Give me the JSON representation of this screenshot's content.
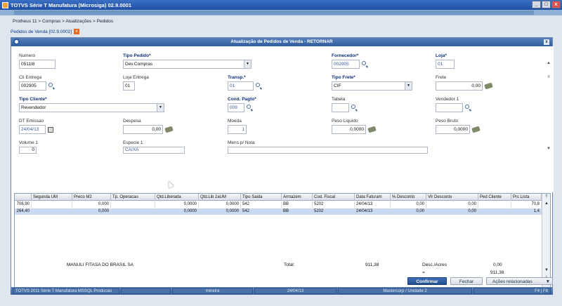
{
  "window": {
    "title": "TOTVS Série T Manufatura (Microsiga) 02.9.0001",
    "controls": [
      "_",
      "□",
      "x"
    ]
  },
  "breadcrumb": "Protheus 11 > Compras > Atualizações > Pedidos",
  "route_tab": {
    "label": "Pedidos de Venda [02.9.0002]",
    "close": "x"
  },
  "dialog": {
    "title": "Atualização de Pedidos de Venda - RETORNAR",
    "close": "x"
  },
  "form": {
    "numero": {
      "label": "Numero",
      "value": "0511I8"
    },
    "tipo_pedido": {
      "label": "Tipo Pedido*",
      "value": "Dev.Compras"
    },
    "fornecedor": {
      "label": "Fornecedor*",
      "value": "002905"
    },
    "loja": {
      "label": "Loja*",
      "value": "01"
    },
    "cli_entrega": {
      "label": "Cli Entrega",
      "value": "002905"
    },
    "loja_entrega": {
      "label": "Loja Entrega",
      "value": "01"
    },
    "transp": {
      "label": "Transp.*",
      "value": "01"
    },
    "tipo_frete": {
      "label": "Tipo Frete*",
      "value": "CIF"
    },
    "frete": {
      "label": "Frete",
      "value": "0,00"
    },
    "tipo_cliente": {
      "label": "Tipo Cliente*",
      "value": "Revendedor"
    },
    "cond_pagto": {
      "label": "Cond. Pagto*",
      "value": "009"
    },
    "tabela": {
      "label": "Tabela",
      "value": ""
    },
    "vendedor1": {
      "label": "Vendedor 1",
      "value": ""
    },
    "dt_emissao": {
      "label": "DT Emissao",
      "value": "24/04/13"
    },
    "despesa": {
      "label": "Despesa",
      "value": "0,00"
    },
    "moeda": {
      "label": "Moeda",
      "value": "1"
    },
    "peso_liquido": {
      "label": "Peso Liquido",
      "value": "0,0000"
    },
    "peso_bruto": {
      "label": "Peso Bruto",
      "value": "0,0000"
    },
    "volume1": {
      "label": "Volume 1",
      "value": "0"
    },
    "especie1": {
      "label": "Especie 1",
      "value": "CAIXA"
    },
    "menu_nota": {
      "label": "Mens.p/ Nota",
      "value": ""
    }
  },
  "grid": {
    "columns": [
      "Segunda UM",
      "Preco M2",
      "Tp. Operacao",
      "Qtd.Liberada",
      "Qtd.Lib 2aUM",
      "Tipo Saida",
      "Armazem",
      "Cod. Fiscal",
      "Data Faturam",
      "% Desconto",
      "Vlr Desconto",
      "Ped Cliente",
      "Prc Lista"
    ],
    "rows": [
      [
        "706,90",
        "",
        "0,000",
        "",
        "0,0000",
        "0,0000",
        "542",
        "BB",
        "5202",
        "24/04/13",
        "0,00",
        "0,00",
        "",
        "70,8"
      ],
      [
        "264,40",
        "",
        "0,000",
        "",
        "0,0000",
        "0,0000",
        "542",
        "BB",
        "5202",
        "24/04/13",
        "0,00",
        "0,00",
        "",
        "1,4"
      ]
    ]
  },
  "totals": {
    "customer": "MANULI FITASA DO BRASIL SA",
    "total_label": "Total:",
    "total_value": "911,38",
    "desc_label": "Desc./Acres",
    "desc_value": "0,00",
    "eq_label": "=",
    "eq_value": "911,38"
  },
  "buttons": {
    "confirm": "Confirmar",
    "close": "Fechar",
    "related": "Ações relacionadas"
  },
  "status": {
    "product": "TOTVS 2011 Série T Manufatura MSSQL Producao",
    "blank": "",
    "user": "mineira",
    "date": "24/04/13",
    "company": "Mastercorp / Unidade 2",
    "keys": "F4 | F8"
  },
  "colors": {
    "accent": "#2f5e9f",
    "selected_row": "#c9d9f2"
  }
}
